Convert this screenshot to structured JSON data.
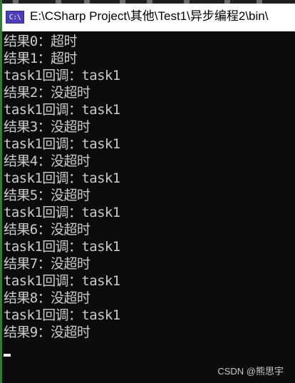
{
  "window": {
    "title": "E:\\CSharp Project\\其他\\Test1\\异步编程2\\bin\\",
    "icon": "console-app-icon",
    "icon_text": "C:\\"
  },
  "console": {
    "lines": [
      "结果0：超时",
      "结果1：超时",
      "task1回调：task1",
      "结果2：没超时",
      "task1回调：task1",
      "结果3：没超时",
      "task1回调：task1",
      "结果4：没超时",
      "task1回调：task1",
      "结果5：没超时",
      "task1回调：task1",
      "结果6：没超时",
      "task1回调：task1",
      "结果7：没超时",
      "task1回调：task1",
      "结果8：没超时",
      "task1回调：task1",
      "结果9：没超时"
    ]
  },
  "watermark": "CSDN @熊思宇",
  "colors": {
    "background": "#0c0c0c",
    "text": "#cccccc",
    "titlebar": "#ffffff",
    "accent": "#2f7d32"
  }
}
